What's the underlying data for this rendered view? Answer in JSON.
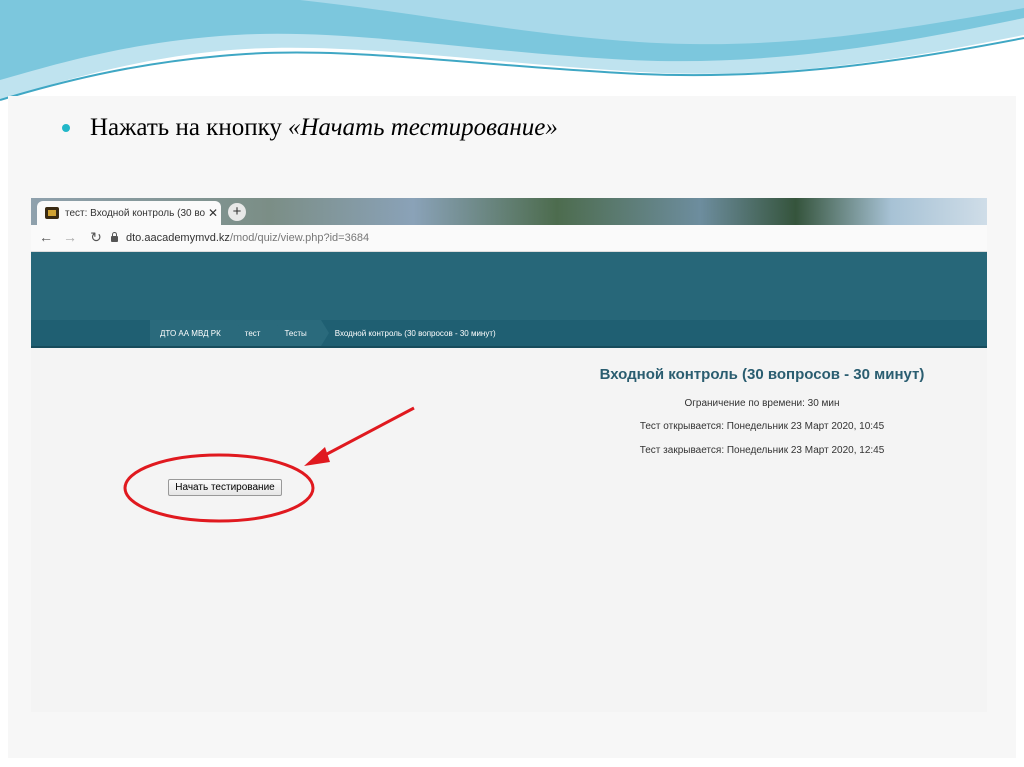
{
  "slide": {
    "bullet_text": "Нажать на кнопку",
    "bullet_emphasis": "«Начать тестирование»",
    "accent_color": "#22b7c8",
    "annotation_color": "#e0191f"
  },
  "browser": {
    "tab_title": "тест: Входной контроль (30 вопро",
    "tab_close": "✕",
    "new_tab": "+",
    "url_host": "dto.aacademymvd.kz",
    "url_path": "/mod/quiz/view.php?id=3684",
    "icons": [
      "back-arrow-icon",
      "forward-arrow-icon",
      "reload-icon",
      "lock-icon"
    ]
  },
  "site": {
    "header_color": "#276779",
    "breadcrumb": [
      "ДТО АА МВД РК",
      "тест",
      "Тесты",
      "Входной контроль (30 вопросов - 30 минут)"
    ]
  },
  "quiz": {
    "title": "Входной контроль (30 вопросов - 30 минут)",
    "time_limit": "Ограничение по времени: 30 мин",
    "opens": "Тест открывается: Понедельник 23 Март 2020, 10:45",
    "closes": "Тест закрывается: Понедельник 23 Март 2020, 12:45",
    "start_button": "Начать тестирование"
  }
}
